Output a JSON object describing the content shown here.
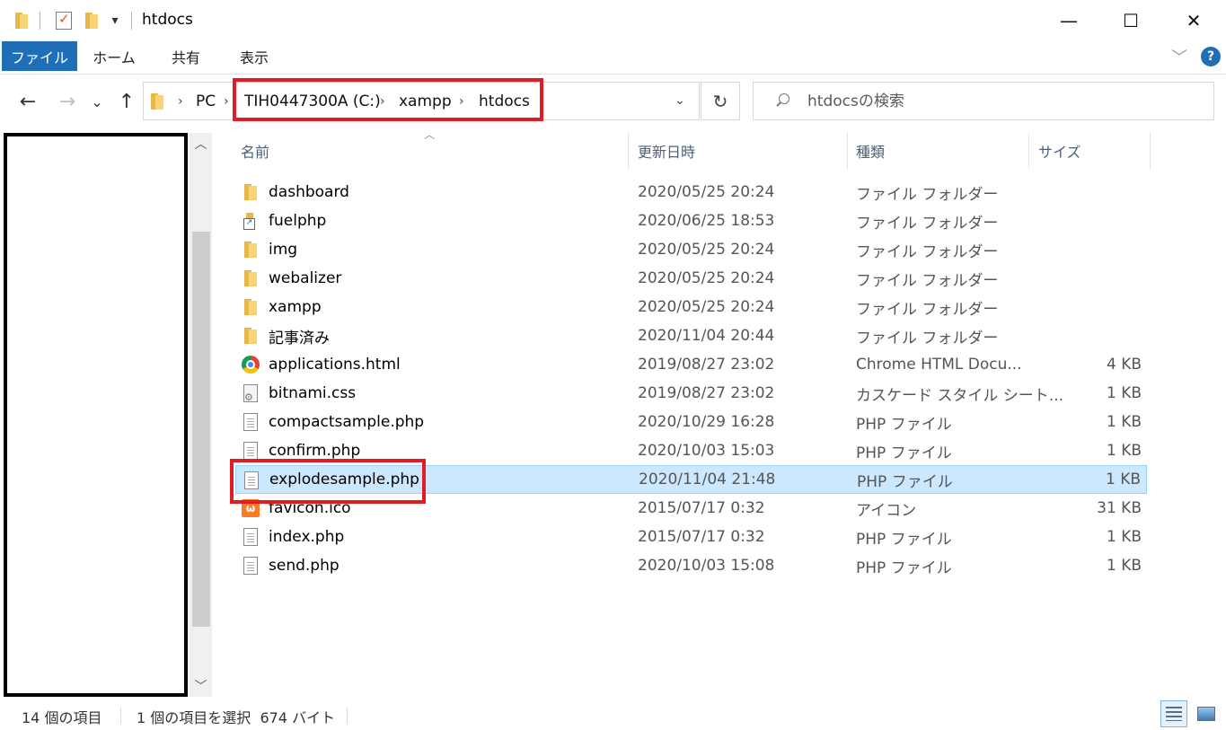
{
  "window": {
    "title": "htdocs",
    "minimize_glyph": "—",
    "maximize_glyph": "☐",
    "close_glyph": "✕",
    "qa_dropdown_glyph": "▾"
  },
  "ribbon": {
    "tabs": [
      "ファイル",
      "ホーム",
      "共有",
      "表示"
    ],
    "expand_glyph": "﹀",
    "help_glyph": "?"
  },
  "nav": {
    "back_glyph": "←",
    "forward_glyph": "→",
    "recent_glyph": "⌄",
    "up_glyph": "↑",
    "path": [
      "PC",
      "TIH0447300A (C:)",
      "xampp",
      "htdocs"
    ],
    "separator_glyph": "›",
    "dropdown_glyph": "⌄",
    "refresh_glyph": "↻",
    "search_placeholder": "htdocsの検索"
  },
  "columns": {
    "name": "名前",
    "date": "更新日時",
    "type": "種類",
    "size": "サイズ"
  },
  "files": [
    {
      "name": "dashboard",
      "date": "2020/05/25 20:24",
      "type": "ファイル フォルダー",
      "size": "",
      "icon": "folder-icon"
    },
    {
      "name": "fuelphp",
      "date": "2020/06/25 18:53",
      "type": "ファイル フォルダー",
      "size": "",
      "icon": "shortcut-folder-icon"
    },
    {
      "name": "img",
      "date": "2020/05/25 20:24",
      "type": "ファイル フォルダー",
      "size": "",
      "icon": "folder-icon"
    },
    {
      "name": "webalizer",
      "date": "2020/05/25 20:24",
      "type": "ファイル フォルダー",
      "size": "",
      "icon": "folder-icon"
    },
    {
      "name": "xampp",
      "date": "2020/05/25 20:24",
      "type": "ファイル フォルダー",
      "size": "",
      "icon": "folder-icon"
    },
    {
      "name": "記事済み",
      "date": "2020/11/04 20:44",
      "type": "ファイル フォルダー",
      "size": "",
      "icon": "folder-icon"
    },
    {
      "name": "applications.html",
      "date": "2019/08/27 23:02",
      "type": "Chrome HTML Docu...",
      "size": "4 KB",
      "icon": "chrome-icon"
    },
    {
      "name": "bitnami.css",
      "date": "2019/08/27 23:02",
      "type": "カスケード スタイル シート...",
      "size": "1 KB",
      "icon": "css-file-icon"
    },
    {
      "name": "compactsample.php",
      "date": "2020/10/29 16:28",
      "type": "PHP ファイル",
      "size": "1 KB",
      "icon": "document-icon"
    },
    {
      "name": "confirm.php",
      "date": "2020/10/03 15:03",
      "type": "PHP ファイル",
      "size": "1 KB",
      "icon": "document-icon"
    },
    {
      "name": "explodesample.php",
      "date": "2020/11/04 21:48",
      "type": "PHP ファイル",
      "size": "1 KB",
      "icon": "document-icon",
      "selected": true
    },
    {
      "name": "favicon.ico",
      "date": "2015/07/17 0:32",
      "type": "アイコン",
      "size": "31 KB",
      "icon": "xampp-icon"
    },
    {
      "name": "index.php",
      "date": "2015/07/17 0:32",
      "type": "PHP ファイル",
      "size": "1 KB",
      "icon": "document-icon"
    },
    {
      "name": "send.php",
      "date": "2020/10/03 15:08",
      "type": "PHP ファイル",
      "size": "1 KB",
      "icon": "document-icon"
    }
  ],
  "status": {
    "item_count": "14 個の項目",
    "selection": "1 個の項目を選択  674 バイト"
  },
  "colors": {
    "file_tab": "#1e6fb7",
    "highlight_red": "#e01c24",
    "selection_bg": "#cce8ff"
  }
}
